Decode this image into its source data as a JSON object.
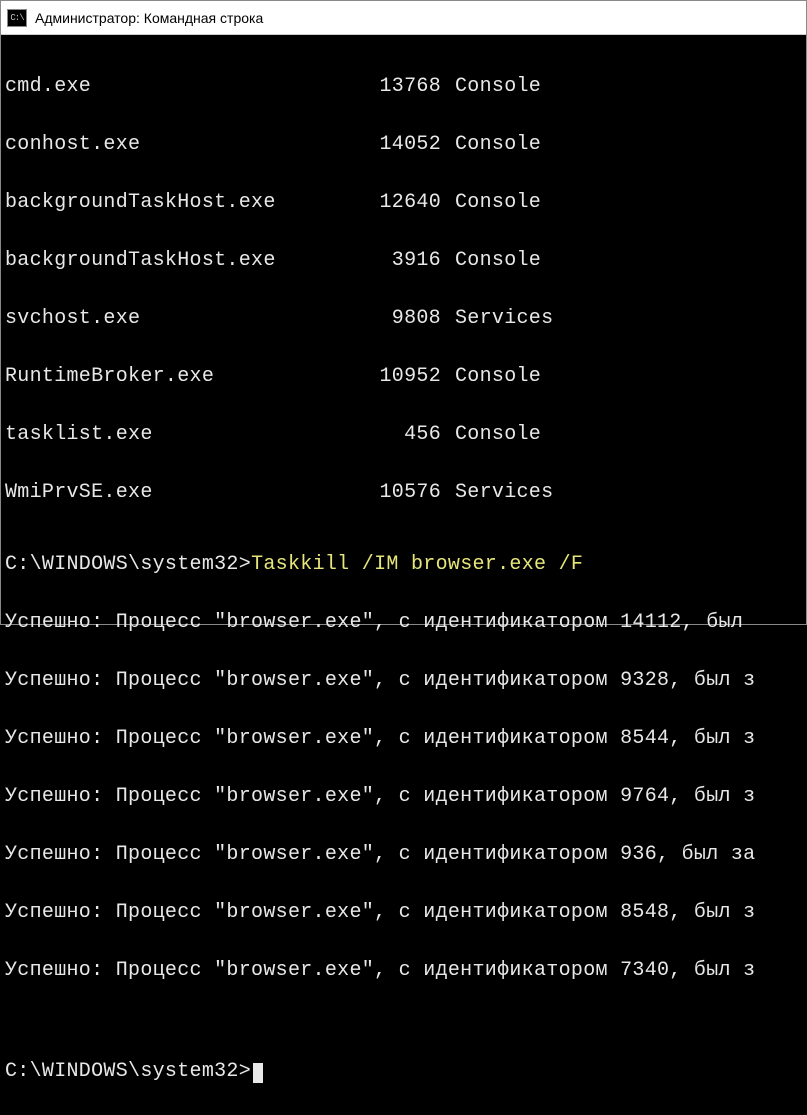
{
  "window": {
    "title": "Администратор: Командная строка",
    "icon_glyph": "C:\\"
  },
  "processes": [
    {
      "name": "cmd.exe",
      "pid": "13768",
      "session": "Console"
    },
    {
      "name": "conhost.exe",
      "pid": "14052",
      "session": "Console"
    },
    {
      "name": "backgroundTaskHost.exe",
      "pid": "12640",
      "session": "Console"
    },
    {
      "name": "backgroundTaskHost.exe",
      "pid": "3916",
      "session": "Console"
    },
    {
      "name": "svchost.exe",
      "pid": "9808",
      "session": "Services"
    },
    {
      "name": "RuntimeBroker.exe",
      "pid": "10952",
      "session": "Console"
    },
    {
      "name": "tasklist.exe",
      "pid": "456",
      "session": "Console"
    },
    {
      "name": "WmiPrvSE.exe",
      "pid": "10576",
      "session": "Services"
    }
  ],
  "prompt1": {
    "path": "C:\\WINDOWS\\system32",
    "arrow": ">",
    "command": "Taskkill /IM browser.exe /F"
  },
  "results": [
    "Успешно: Процесс \"browser.exe\", с идентификатором 14112, был ",
    "Успешно: Процесс \"browser.exe\", с идентификатором 9328, был з",
    "Успешно: Процесс \"browser.exe\", с идентификатором 8544, был з",
    "Успешно: Процесс \"browser.exe\", с идентификатором 9764, был з",
    "Успешно: Процесс \"browser.exe\", с идентификатором 936, был за",
    "Успешно: Процесс \"browser.exe\", с идентификатором 8548, был з",
    "Успешно: Процесс \"browser.exe\", с идентификатором 7340, был з"
  ],
  "prompt2": {
    "path": "C:\\WINDOWS\\system32",
    "arrow": ">"
  }
}
